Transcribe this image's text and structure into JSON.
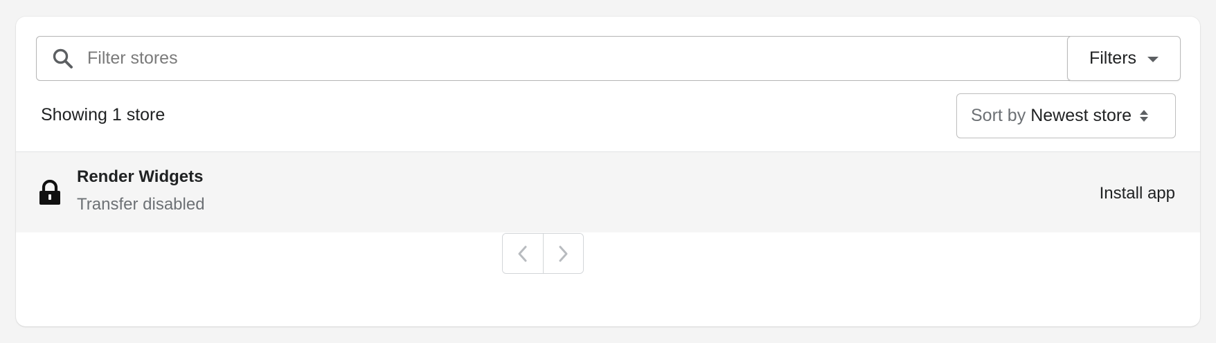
{
  "search": {
    "placeholder": "Filter stores",
    "value": "",
    "icon": "search-icon"
  },
  "filters": {
    "label": "Filters",
    "icon": "caret-down-icon"
  },
  "summary": {
    "showing_text": "Showing 1 store"
  },
  "sort": {
    "prefix": "Sort by",
    "selected": "Newest store",
    "icon": "select-arrows-icon"
  },
  "stores": [
    {
      "name": "Render Widgets",
      "status": "Transfer disabled",
      "icon": "lock-icon",
      "action": "Install app"
    }
  ],
  "pagination": {
    "prev_icon": "chevron-left-icon",
    "next_icon": "chevron-right-icon",
    "prev_enabled": false,
    "next_enabled": false
  },
  "colors": {
    "page_background": "#f4f4f4",
    "card_background": "#ffffff",
    "row_background": "#f5f5f5",
    "text_primary": "#202223",
    "text_subdued": "#6d7175",
    "border": "#b4b4b4"
  }
}
